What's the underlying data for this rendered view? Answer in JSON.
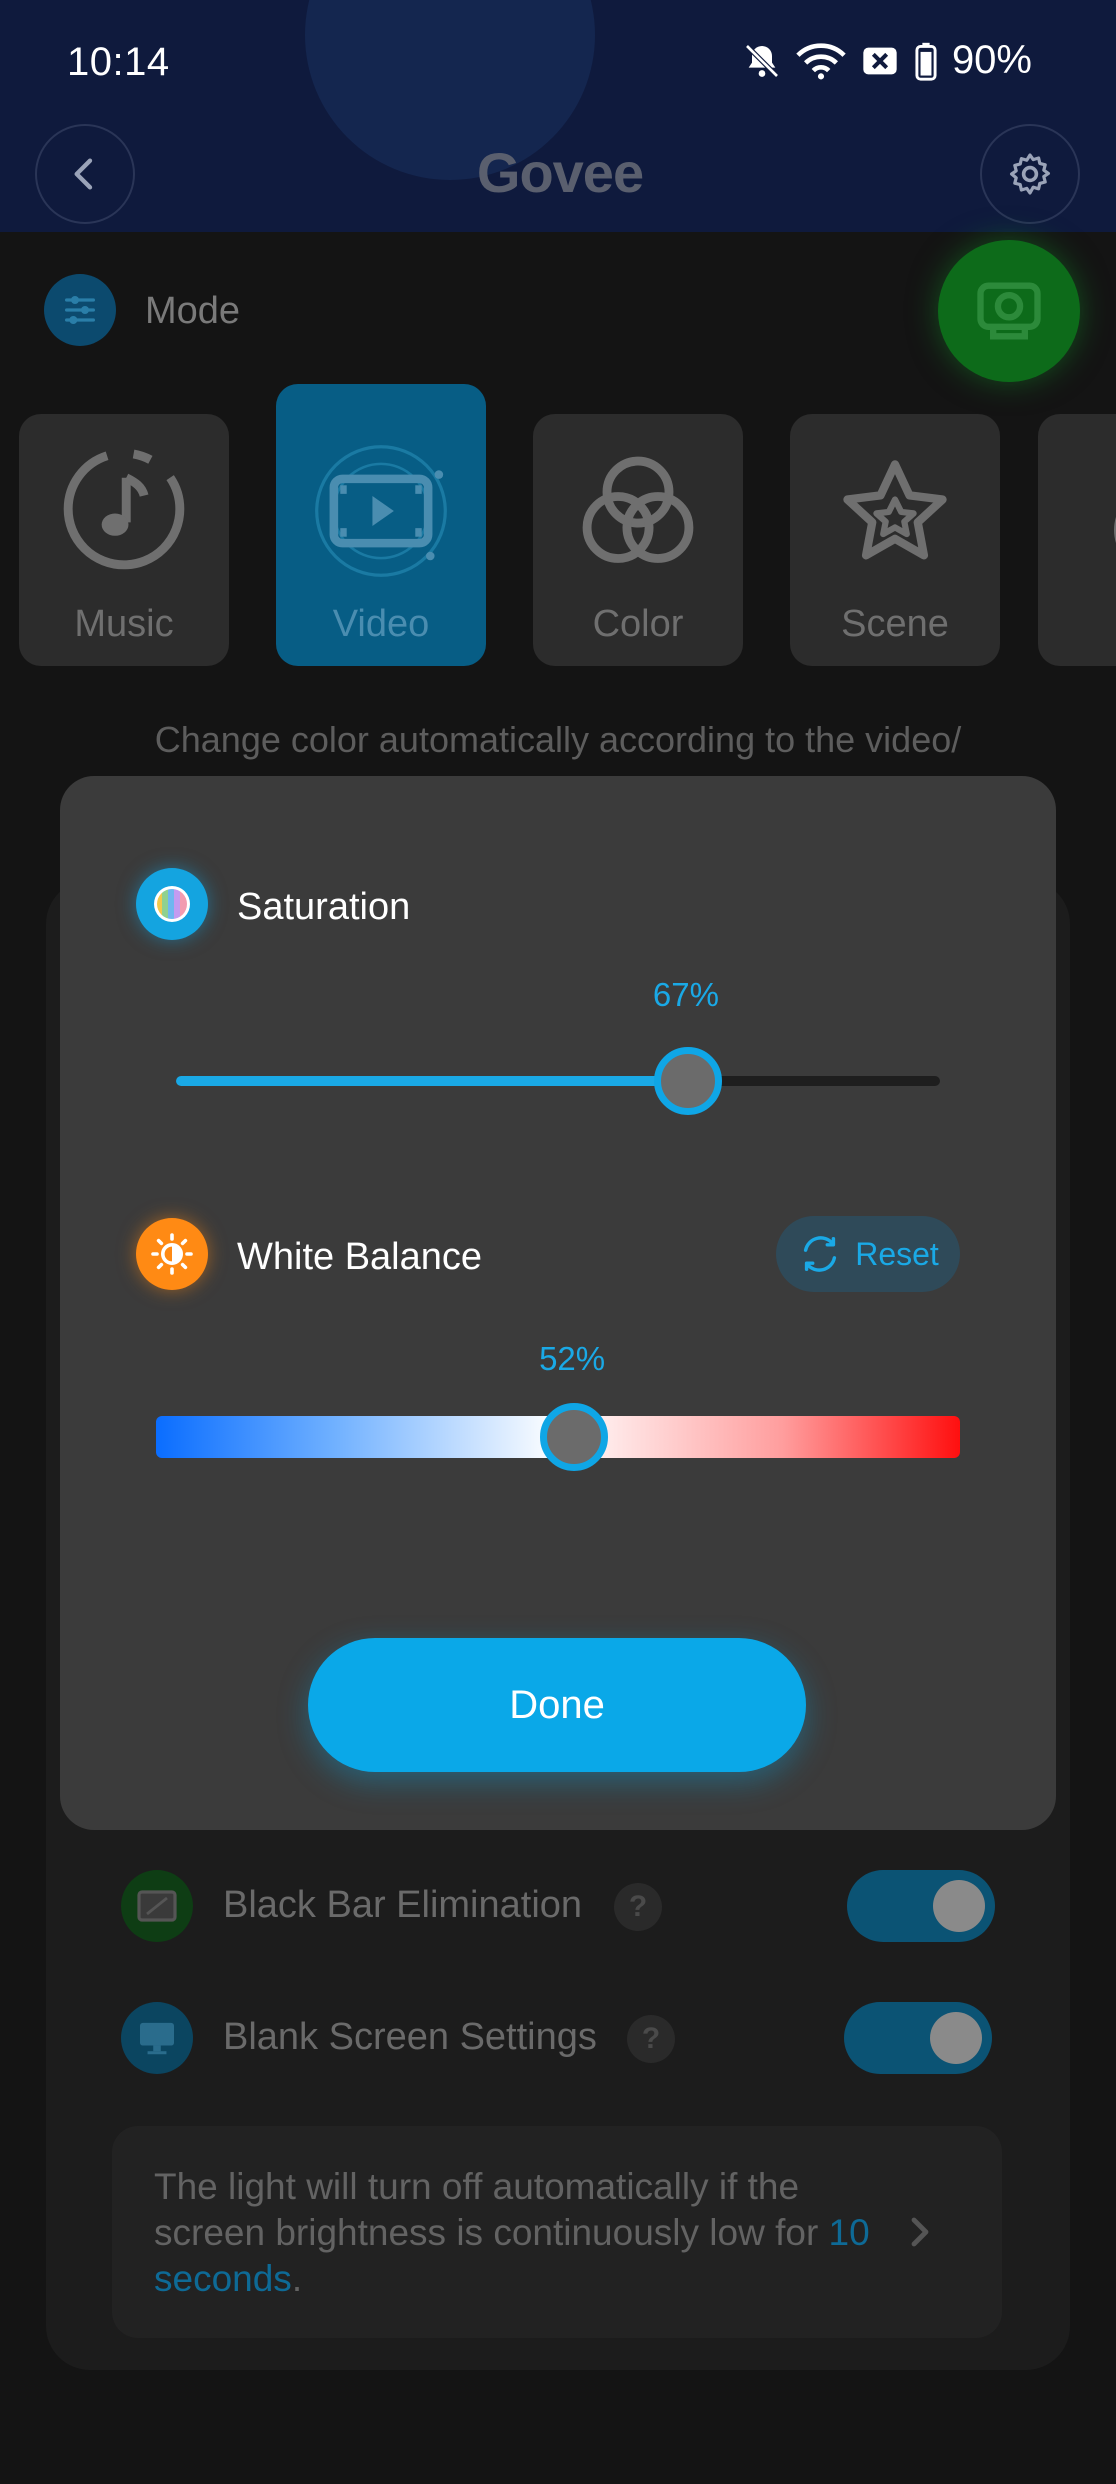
{
  "status_bar": {
    "time": "10:14",
    "battery": "90%"
  },
  "header": {
    "logo": "Govee"
  },
  "mode": {
    "label": "Mode",
    "cards": [
      {
        "label": "Music",
        "icon": "music-note-icon",
        "active": false
      },
      {
        "label": "Video",
        "icon": "video-film-icon",
        "active": true
      },
      {
        "label": "Color",
        "icon": "color-circles-icon",
        "active": false
      },
      {
        "label": "Scene",
        "icon": "star-icon",
        "active": false
      }
    ],
    "description": "Change color automatically according to the video/"
  },
  "settings": {
    "black_bar_label": "Black Bar Elimination",
    "blank_screen_label": "Blank Screen Settings",
    "info_prefix": "The light will turn off automatically if the screen brightness is continuously low for",
    "info_link": "10 seconds",
    "info_suffix": "."
  },
  "dialog": {
    "saturation": {
      "label": "Saturation",
      "value_text": "67%",
      "value": 0.67
    },
    "white_balance": {
      "label": "White Balance",
      "value_text": "52%",
      "value": 0.52
    },
    "reset_label": "Reset",
    "done_label": "Done"
  },
  "colors": {
    "accent": "#1aa9e6",
    "header_bg": "#0f1a3d",
    "dialog_bg": "#3b3b3b"
  }
}
